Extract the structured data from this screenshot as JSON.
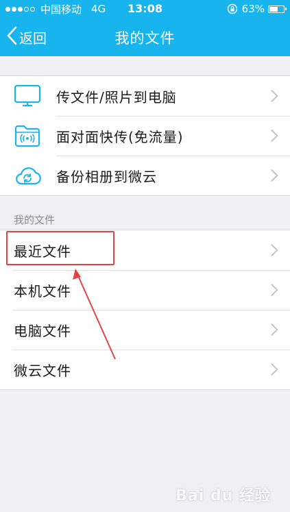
{
  "status_bar": {
    "carrier": "中国移动",
    "network": "4G",
    "time": "13:08",
    "battery_percent_text": "63%",
    "battery_level": 0.63,
    "signal_bars_filled": 3,
    "signal_bars_total": 5
  },
  "nav": {
    "back_label": "返回",
    "title": "我的文件"
  },
  "actions": [
    {
      "label": "传文件/照片到电脑",
      "icon": "monitor-icon"
    },
    {
      "label": "面对面快传(免流量)",
      "icon": "wireless-folder-icon"
    },
    {
      "label": "备份相册到微云",
      "icon": "cloud-sync-icon"
    }
  ],
  "files_section": {
    "header": "我的文件",
    "items": [
      {
        "label": "最近文件"
      },
      {
        "label": "本机文件"
      },
      {
        "label": "电脑文件"
      },
      {
        "label": "微云文件"
      }
    ]
  },
  "annotation": {
    "highlighted_item": "最近文件",
    "color": "#e04545"
  },
  "colors": {
    "accent": "#18b4ed",
    "background": "#efeff4"
  },
  "watermark": "Bai du 经验"
}
